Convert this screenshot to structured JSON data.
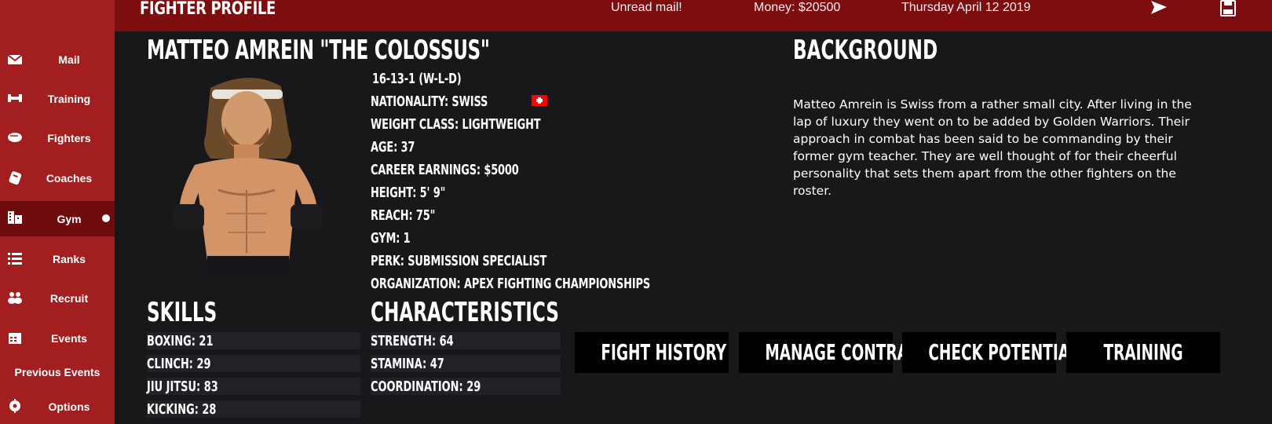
{
  "header": {
    "title": "FIGHTER PROFILE",
    "mail": "Unread mail!",
    "money": "Money: $20500",
    "date": "Thursday April 12 2019",
    "icons": [
      "send-icon",
      "save-icon"
    ]
  },
  "sidebar": {
    "items": [
      {
        "label": "Mail",
        "icon": "mail-icon"
      },
      {
        "label": "Training",
        "icon": "dumbbell-icon"
      },
      {
        "label": "Fighters",
        "icon": "glove-icon"
      },
      {
        "label": "Coaches",
        "icon": "clipboard-icon"
      },
      {
        "label": "Gym",
        "icon": "building-icon",
        "active": true
      },
      {
        "label": "Ranks",
        "icon": "list-icon"
      },
      {
        "label": "Recruit",
        "icon": "users-icon"
      },
      {
        "label": "Events",
        "icon": "calendar-icon"
      },
      {
        "label": "Previous Events"
      },
      {
        "label": "Options",
        "icon": "gear-icon"
      }
    ]
  },
  "fighter": {
    "name": "MATTEO AMREIN \"THE COLOSSUS\"",
    "record": "16-13-1 (W-L-D)",
    "nationality": "NATIONALITY: SWISS",
    "flag_colors": {
      "field": "#ff0000",
      "cross": "#ffffff"
    },
    "weight_class": "WEIGHT CLASS: LIGHTWEIGHT",
    "age": "AGE: 37",
    "earnings": "CAREER EARNINGS: $5000",
    "height": "HEIGHT: 5' 9\"",
    "reach": "REACH: 75\"",
    "gym": "GYM: 1",
    "perk": "PERK: SUBMISSION SPECIALIST",
    "organization": "ORGANIZATION: APEX FIGHTING CHAMPIONSHIPS"
  },
  "background": {
    "heading": "BACKGROUND",
    "text": "Matteo Amrein is Swiss from a rather small city. After living in the lap of luxury they went on to be added by Golden Warriors. Their approach in combat has been said to be commanding by their former gym teacher. They are well thought of for their cheerful personality that sets them apart from the other fighters on the roster."
  },
  "skills": {
    "heading": "SKILLS",
    "items": [
      "BOXING: 21",
      "CLINCH: 29",
      "JIU JITSU: 83",
      "KICKING: 28"
    ]
  },
  "characteristics": {
    "heading": "CHARACTERISTICS",
    "items": [
      "STRENGTH: 64",
      "STAMINA: 47",
      "COORDINATION: 29"
    ]
  },
  "actions": {
    "fight_history": "FIGHT HISTORY",
    "manage_contract": "MANAGE CONTRACT",
    "check_potential": "CHECK POTENTIAL",
    "training": "TRAINING"
  },
  "colors": {
    "sidebar": "#a31e1f",
    "sidebar_active": "#6e0b0c",
    "topbar": "#7d0d0e",
    "background": "#18181b"
  }
}
